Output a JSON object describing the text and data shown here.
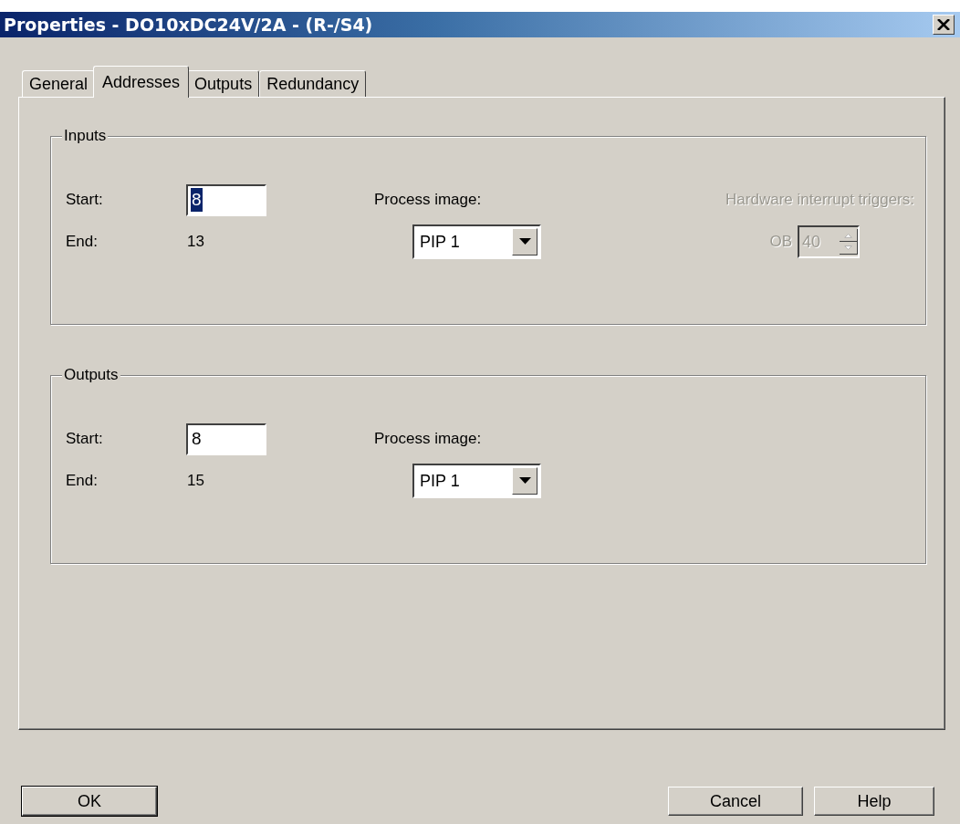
{
  "window": {
    "title": "Properties - DO10xDC24V/2A - (R-/S4)"
  },
  "tabs": [
    {
      "label": "General",
      "selected": false
    },
    {
      "label": "Addresses",
      "selected": true
    },
    {
      "label": "Outputs",
      "selected": false
    },
    {
      "label": "Redundancy",
      "selected": false
    }
  ],
  "groups": [
    {
      "title": "Inputs",
      "start": {
        "label": "Start:",
        "value": "8",
        "text_selected": true
      },
      "end": {
        "label": "End:",
        "value": "13"
      },
      "process_image": {
        "label": "Process image:",
        "value": "PIP 1"
      },
      "hardware_interrupt": {
        "label": "Hardware interrupt triggers:",
        "ob_label": "OB",
        "value": "40",
        "disabled": true
      }
    },
    {
      "title": "Outputs",
      "start": {
        "label": "Start:",
        "value": "8",
        "text_selected": false
      },
      "end": {
        "label": "End:",
        "value": "15"
      },
      "process_image": {
        "label": "Process image:",
        "value": "PIP 1"
      }
    }
  ],
  "buttons_left": [
    {
      "label": "OK",
      "default": true
    }
  ],
  "buttons_right": [
    {
      "label": "Cancel",
      "default": false
    },
    {
      "label": "Help",
      "default": false
    }
  ]
}
